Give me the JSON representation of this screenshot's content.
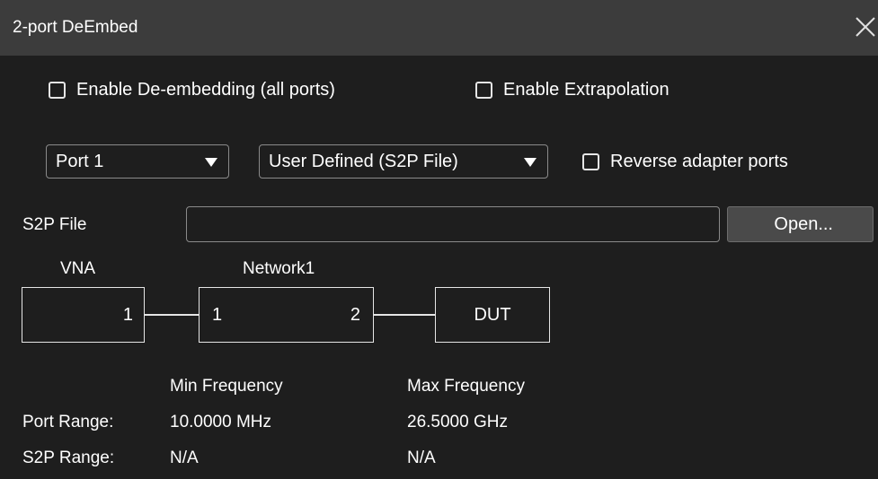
{
  "dialog": {
    "title": "2-port DeEmbed",
    "close_icon": "close-icon"
  },
  "options": {
    "enable_deembedding_label": "Enable De-embedding (all ports)",
    "enable_deembedding_checked": false,
    "enable_extrapolation_label": "Enable Extrapolation",
    "enable_extrapolation_checked": false,
    "reverse_adapter_label": "Reverse adapter ports",
    "reverse_adapter_checked": false
  },
  "port_select": {
    "value": "Port 1"
  },
  "type_select": {
    "value": "User Defined (S2P File)"
  },
  "s2p": {
    "label": "S2P File",
    "value": "",
    "open_label": "Open..."
  },
  "diagram": {
    "vna_label": "VNA",
    "vna_port": "1",
    "network_label": "Network1",
    "network_port_left": "1",
    "network_port_right": "2",
    "dut_label": "DUT"
  },
  "frequency": {
    "min_header": "Min Frequency",
    "max_header": "Max Frequency",
    "port_range_label": "Port Range:",
    "port_min": "10.0000 MHz",
    "port_max": "26.5000 GHz",
    "s2p_range_label": "S2P Range:",
    "s2p_min": "N/A",
    "s2p_max": "N/A"
  }
}
